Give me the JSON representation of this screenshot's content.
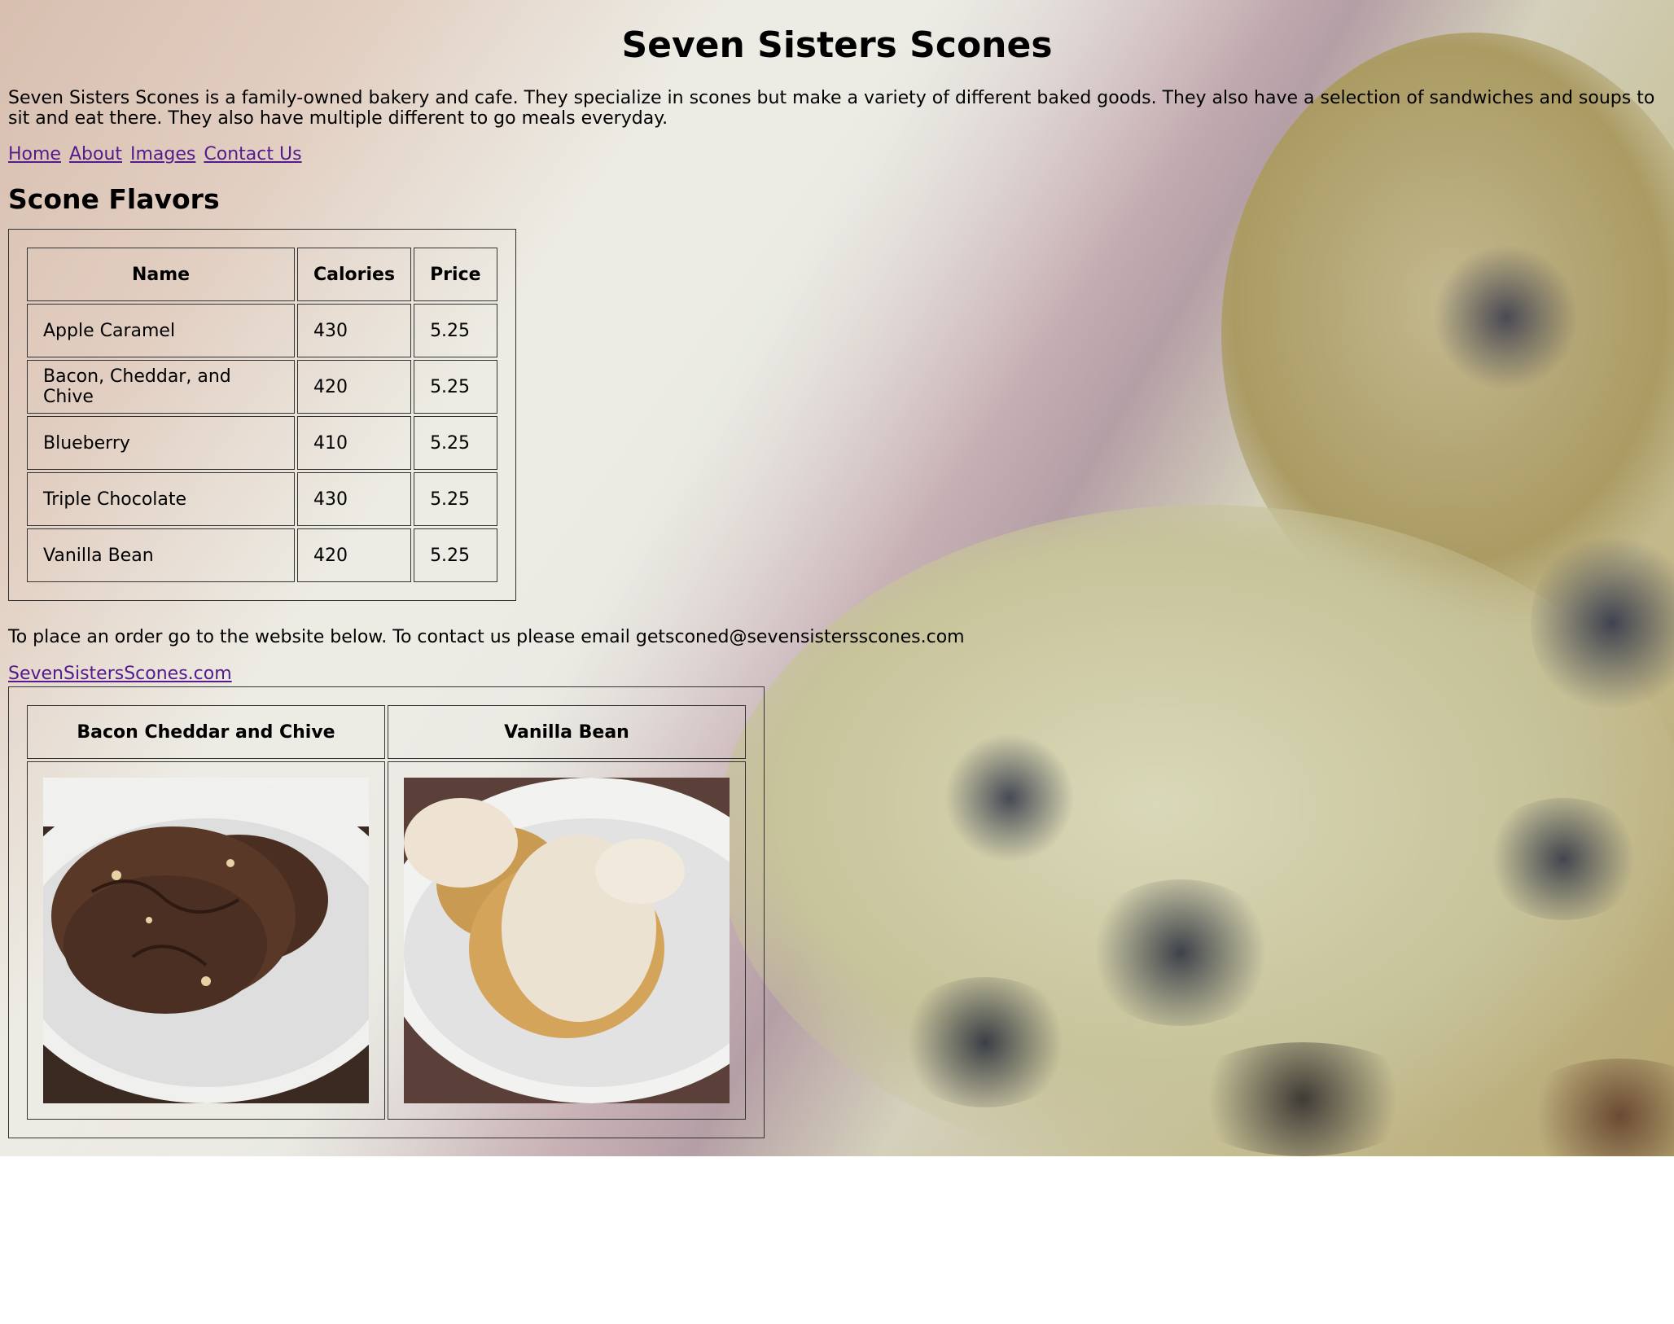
{
  "header": {
    "title": "Seven Sisters Scones"
  },
  "intro": "Seven Sisters Scones is a family-owned bakery and cafe. They specialize in scones but make a variety of different baked goods. They also have a selection of sandwiches and soups to sit and eat there. They also have multiple different to go meals everyday.",
  "nav": {
    "items": [
      "Home",
      "About",
      "Images",
      "Contact Us"
    ]
  },
  "flavors": {
    "heading": "Scone Flavors",
    "columns": [
      "Name",
      "Calories",
      "Price"
    ],
    "rows": [
      [
        "Apple Caramel",
        "430",
        "5.25"
      ],
      [
        "Bacon, Cheddar, and Chive",
        "420",
        "5.25"
      ],
      [
        "Blueberry",
        "410",
        "5.25"
      ],
      [
        "Triple Chocolate",
        "430",
        "5.25"
      ],
      [
        "Vanilla Bean",
        "420",
        "5.25"
      ]
    ]
  },
  "order_text": "To place an order go to the website below. To contact us please email getsconed@sevensistersscones.com",
  "website_link": "SevenSistersScones.com",
  "gallery": {
    "headers": [
      "Bacon Cheddar and Chive",
      "Vanilla Bean"
    ]
  },
  "colors": {
    "link": "#551a8b",
    "border": "#333333"
  }
}
